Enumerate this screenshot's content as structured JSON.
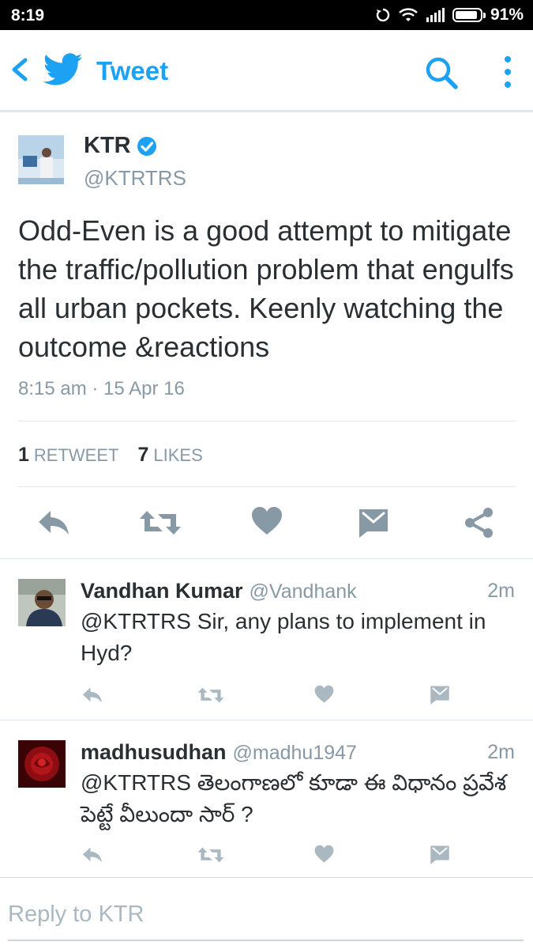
{
  "status_bar": {
    "time": "8:19",
    "battery": "91%",
    "battery_level": 0.91
  },
  "app_bar": {
    "title": "Tweet"
  },
  "tweet": {
    "name": "KTR",
    "handle": "@KTRTRS",
    "text": "Odd-Even is a good attempt to mitigate the traffic/pollution problem that engulfs all urban pockets. Keenly watching the outcome &reactions",
    "time": "8:15 am · 15 Apr 16",
    "retweets_count": "1",
    "retweets_label": "RETWEET",
    "likes_count": "7",
    "likes_label": "LIKES"
  },
  "replies": [
    {
      "name": "Vandhan Kumar",
      "handle": "@Vandhank",
      "time": "2m",
      "text": "@KTRTRS Sir, any plans to implement in Hyd?"
    },
    {
      "name": "madhusudhan",
      "handle": "@madhu1947",
      "time": "2m",
      "text": "@KTRTRS తెలంగాణలో కూడా ఈ విధానం ప్రవేశ పెట్టే వీలుందా సార్ ?"
    }
  ],
  "reply_box": {
    "placeholder": "Reply to KTR"
  },
  "colors": {
    "accent": "#1da1f2",
    "icon_gray": "#8899a6",
    "verified": "#1da1f2"
  }
}
